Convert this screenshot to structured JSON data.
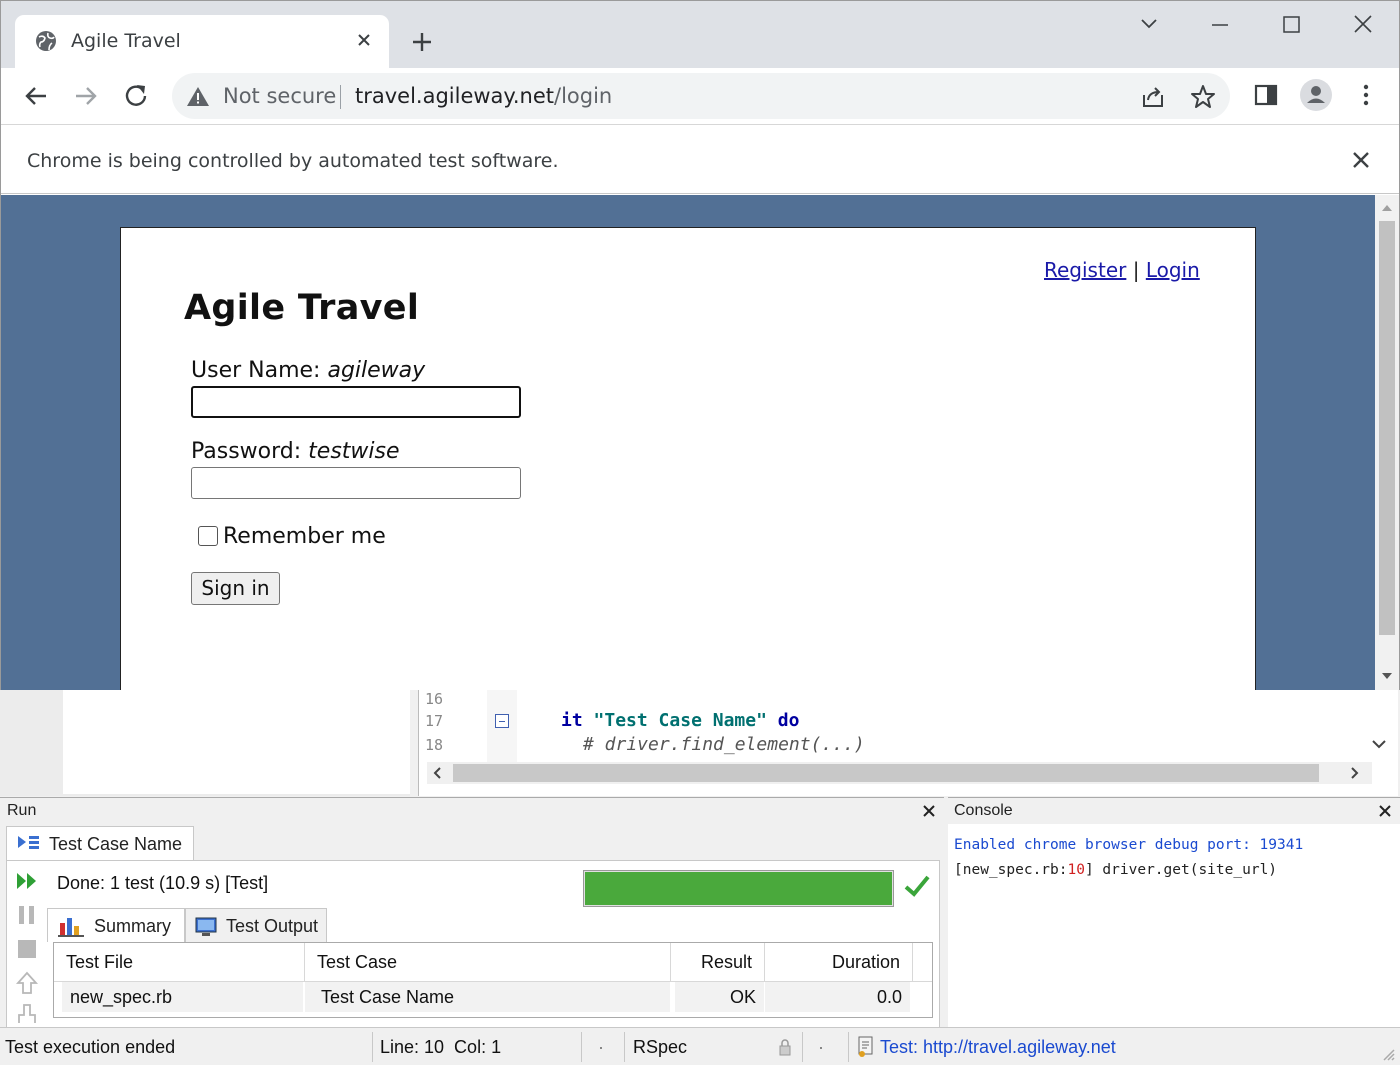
{
  "browser": {
    "tab_title": "Agile Travel",
    "address": {
      "security_label": "Not secure",
      "host": "travel.agileway.net",
      "path": "/login"
    },
    "infobar_text": "Chrome is being controlled by automated test software."
  },
  "page": {
    "heading": "Agile Travel",
    "register_link": "Register",
    "link_separator": "|",
    "login_link": "Login",
    "username_label": "User Name:",
    "username_hint": "agileway",
    "username_value": "",
    "password_label": "Password:",
    "password_hint": "testwise",
    "password_value": "",
    "remember_label": "Remember me",
    "remember_checked": false,
    "signin_label": "Sign in"
  },
  "editor": {
    "lines": [
      {
        "number": "16"
      },
      {
        "number": "17",
        "keyword": "it",
        "string": "\"Test Case Name\"",
        "keyword2": "do"
      },
      {
        "number": "18",
        "comment": "# driver.find_element(...)"
      }
    ]
  },
  "run_panel": {
    "title": "Run",
    "tab_label": "Test Case Name",
    "status_text": "Done: 1 test (10.9 s) [Test]",
    "progress_fraction": 1.0,
    "progress_color": "#4aa93c",
    "subtabs": [
      "Summary",
      "Test Output"
    ],
    "table": {
      "columns": [
        "Test File",
        "Test Case",
        "Result",
        "Duration"
      ],
      "rows": [
        [
          "new_spec.rb",
          "Test Case Name",
          "OK",
          "0.0"
        ]
      ]
    }
  },
  "console": {
    "title": "Console",
    "line1": "Enabled chrome browser debug port: 19341",
    "line2_prefix": "[new_spec.rb:",
    "line2_num": "10",
    "line2_suffix": "] driver.get(site_url)"
  },
  "statusbar": {
    "message": "Test execution ended",
    "position": "Line: 10  Col: 1",
    "dot1": "·",
    "framework": "RSpec",
    "dot2": "·",
    "target": "Test: http://travel.agileway.net"
  }
}
